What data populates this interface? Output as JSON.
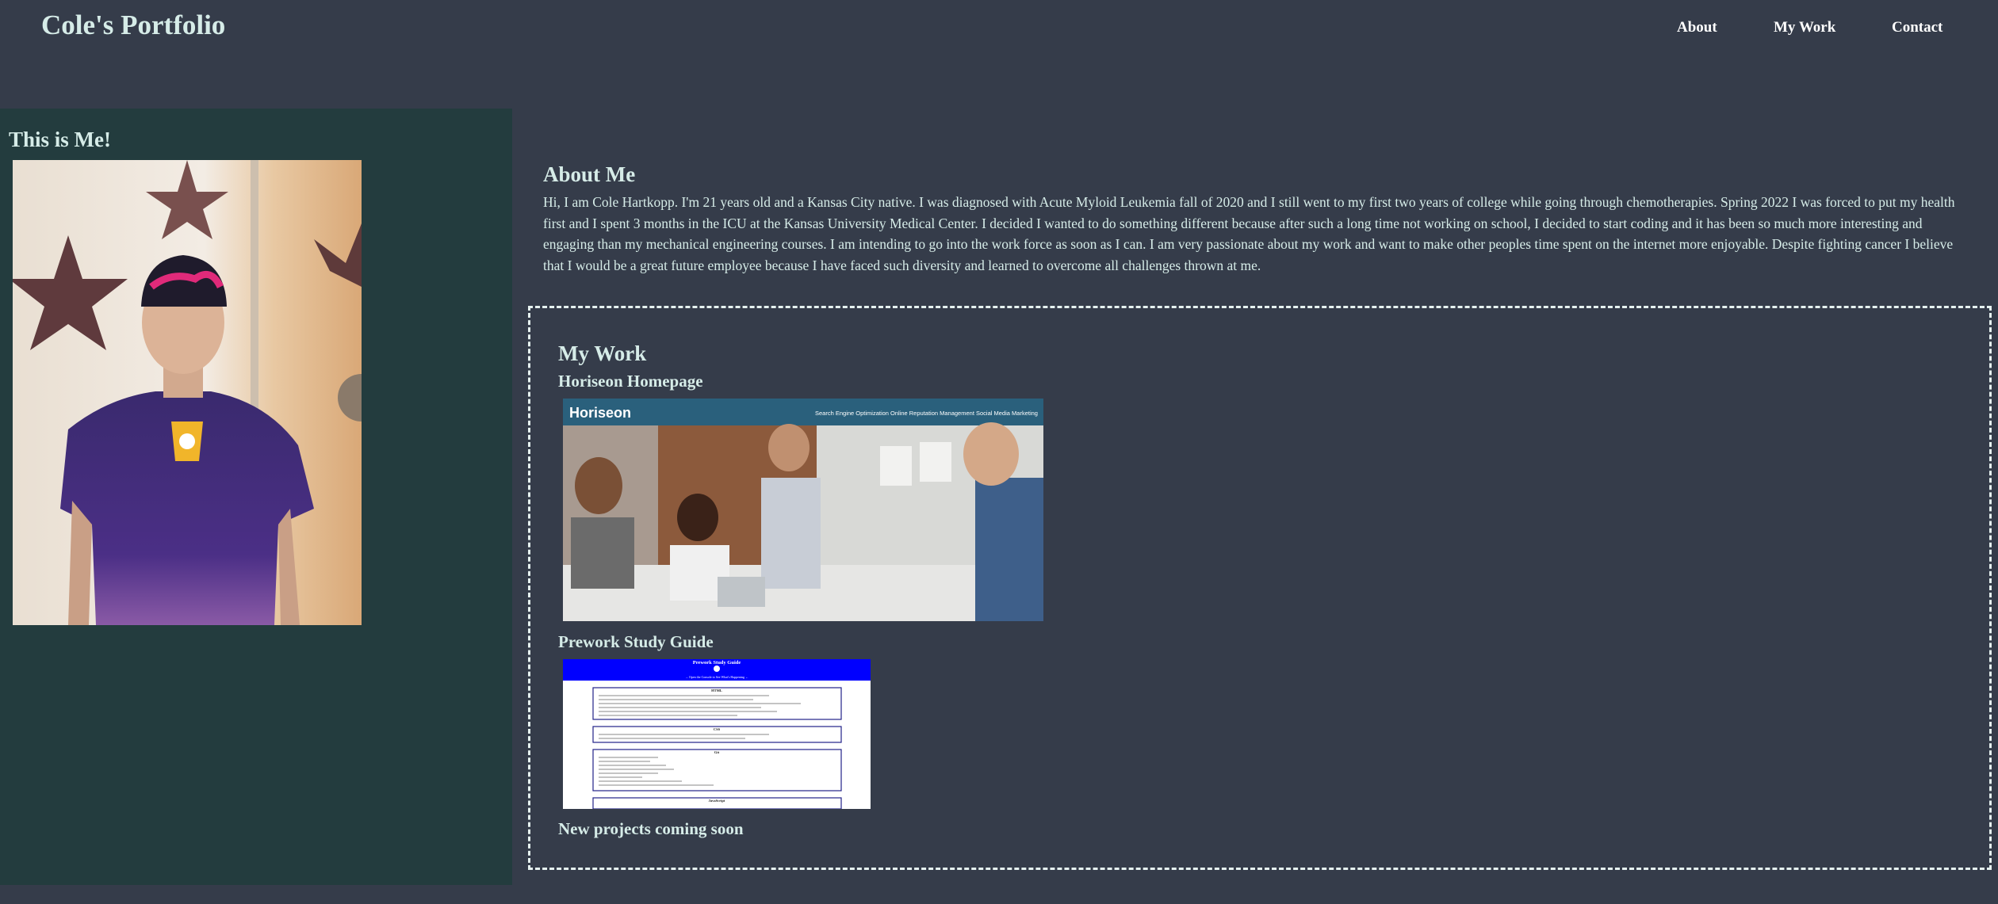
{
  "header": {
    "logo": "Cole's Portfolio",
    "nav": [
      "About",
      "My Work",
      "Contact"
    ]
  },
  "sidebar": {
    "title": "This is Me!"
  },
  "about": {
    "title": "About Me",
    "body": "Hi, I am Cole Hartkopp. I'm 21 years old and a Kansas City native. I was diagnosed with Acute Myloid Leukemia fall of 2020 and I still went to my first two years of college while going through chemotherapies. Spring 2022 I was forced to put my health first and I spent 3 months in the ICU at the Kansas University Medical Center. I decided I wanted to do something different because after such a long time not working on school, I decided to start coding and it has been so much more interesting and engaging than my mechanical engineering courses. I am intending to go into the work force as soon as I can. I am very passionate about my work and want to make other peoples time spent on the internet more enjoyable. Despite fighting cancer I believe that I would be a great future employee because I have faced such diversity and learned to overcome all challenges thrown at me."
  },
  "work": {
    "title": "My Work",
    "projects": [
      {
        "title": "Horiseon Homepage",
        "thumb_brand": "Horiseon",
        "thumb_nav": [
          "Search Engine Optimization",
          "Online Reputation Management",
          "Social Media Marketing"
        ]
      },
      {
        "title": "Prework Study Guide",
        "thumb_title": "Prework Study Guide",
        "thumb_sub": "→ Open the Console to See What's Happening ←",
        "thumb_sections": [
          "HTML",
          "CSS",
          "Git",
          "JavaScript"
        ]
      }
    ],
    "coming_soon": "New projects coming soon"
  },
  "colors": {
    "page_bg": "#353c4a",
    "sidebar_bg": "#233c3e",
    "text": "#d6ece8",
    "horiseon_bar": "#2a607c",
    "prework_banner": "#0000ff"
  }
}
